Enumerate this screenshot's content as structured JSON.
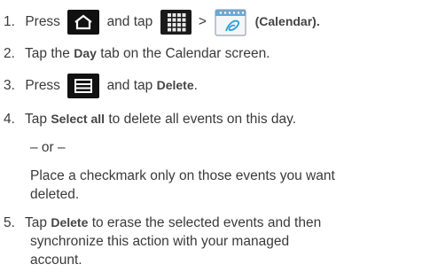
{
  "steps": [
    {
      "num": "1.",
      "pre": "Press",
      "mid": "and tap",
      "gt": ">",
      "bold": "(Calendar)."
    },
    {
      "num": "2.",
      "pre": "Tap the",
      "bold": "Day",
      "post": "tab on the Calendar screen."
    },
    {
      "num": "3.",
      "pre": "Press",
      "mid": "and tap",
      "bold": "Delete",
      "post": "."
    },
    {
      "num": "4.",
      "pre": "Tap",
      "bold": "Select all",
      "post": "to delete all events on this day."
    },
    {
      "num": "5.",
      "pre": "Tap",
      "bold": "Delete",
      "post": "to erase the selected events and then"
    }
  ],
  "or_text": "– or –",
  "alt_line1": "Place a checkmark only on those events you want",
  "alt_line2": "deleted.",
  "step5_line2": "synchronize this action with your managed",
  "step5_line3": "account.",
  "icons": {
    "home": "home-icon",
    "apps": "apps-grid-icon",
    "calendar": "calendar-icon",
    "menu": "menu-icon"
  },
  "colors": {
    "text": "#3a3a3a",
    "icon_bg": "#111111",
    "calendar_accent": "#2a9fd8"
  }
}
